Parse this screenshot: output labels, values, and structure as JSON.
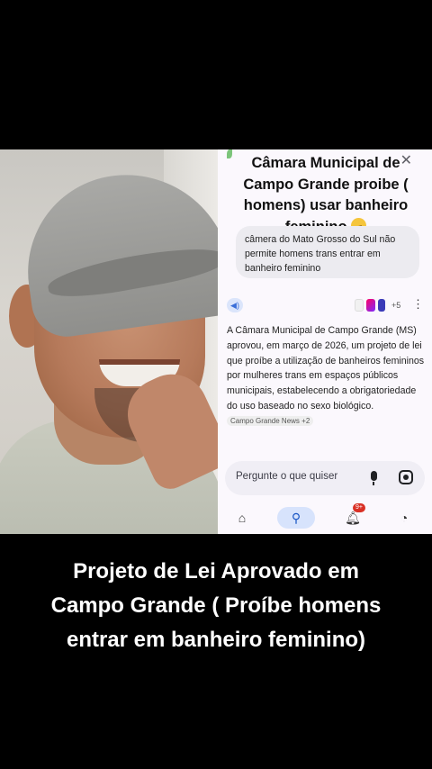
{
  "article": {
    "headline": "Câmara Municipal de Campo Grande proibe ( homens) usar banheiro feminino",
    "headline_emoji": "thinking-face-icon",
    "query_bubble": "câmera do Mato Grosso do Sul não permite homens trans entrar em banheiro feminino",
    "source_count": "+5",
    "answer_text": "A Câmara Municipal de Campo Grande (MS) aprovou, em março de 2026, um projeto de lei que proíbe a utilização de banheiros femininos por mulheres trans em espaços públicos municipais, estabelecendo a obrigatoriedade do uso baseado no sexo biológico.",
    "answer_source_chip": "Campo Grande News +2"
  },
  "search": {
    "placeholder": "Pergunte o que quiser"
  },
  "nav": {
    "notifications_badge": "9+"
  },
  "caption": "Projeto de Lei Aprovado em Campo Grande ( Proíbe homens entrar em banheiro feminino)",
  "colors": {
    "background": "#000000",
    "panel": "#fbf8fd",
    "accent": "#1a56c5",
    "badge": "#d93025"
  }
}
